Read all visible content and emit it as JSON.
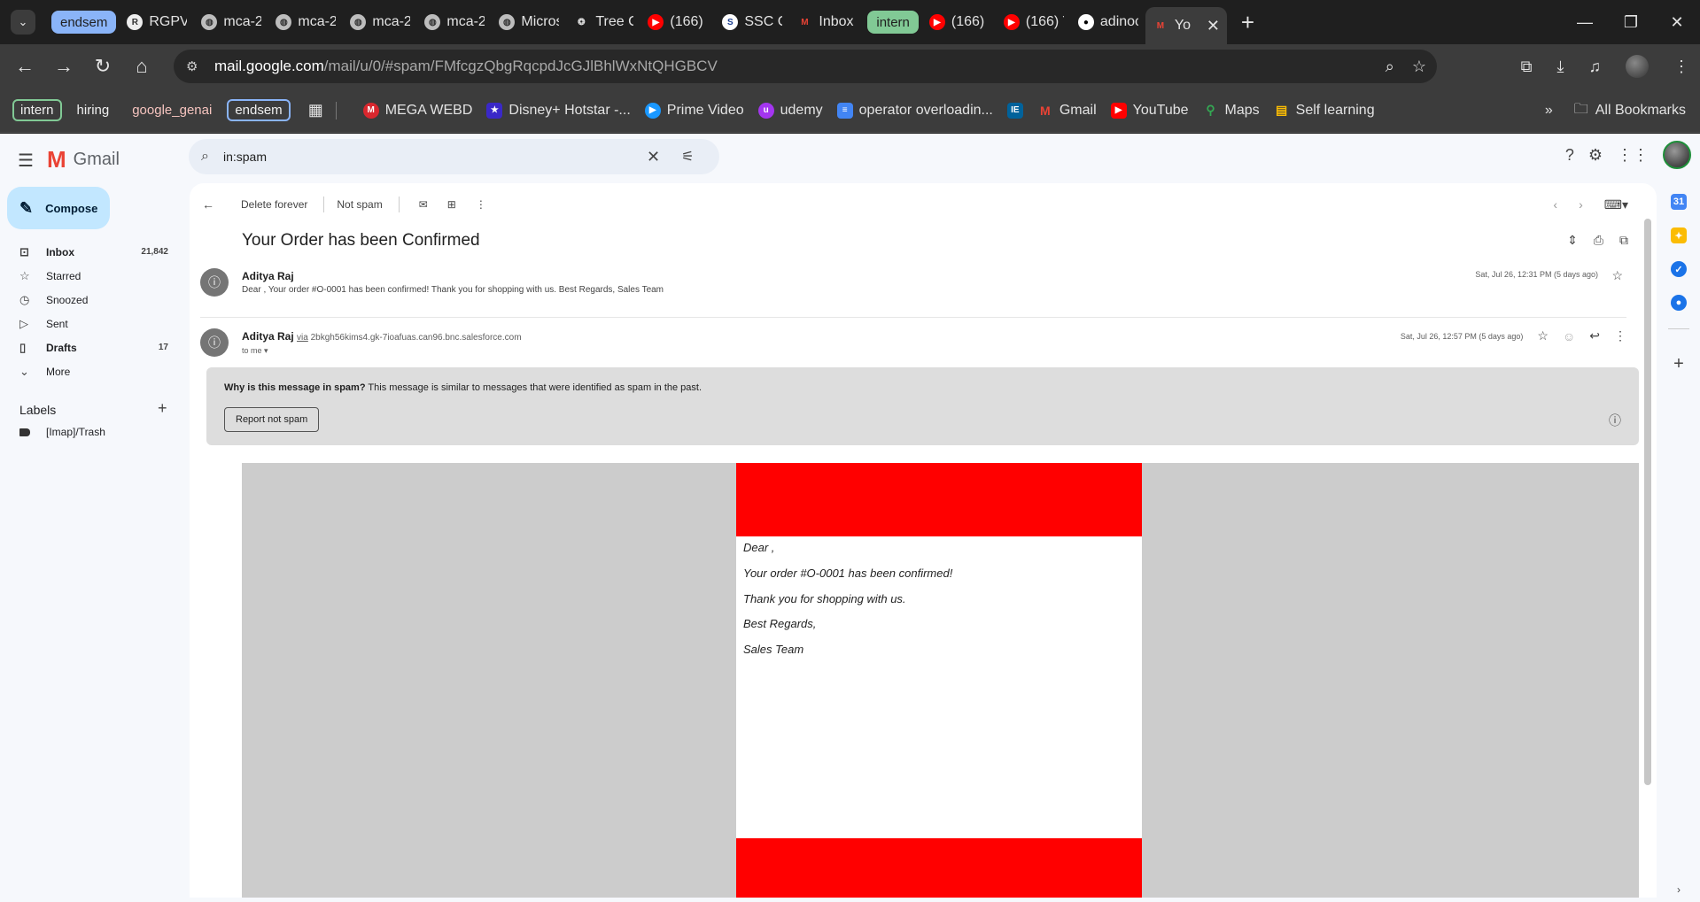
{
  "browser": {
    "tabs": [
      {
        "label": "endsem",
        "type": "group",
        "color": "#8ab4f8",
        "text_color": "#1f1f1f"
      },
      {
        "label": "RGPV",
        "icon": "rgpv-icon"
      },
      {
        "label": "mca-2",
        "icon": "globe-icon"
      },
      {
        "label": "mca-2",
        "icon": "globe-icon"
      },
      {
        "label": "mca-2",
        "icon": "globe-icon"
      },
      {
        "label": "mca-2",
        "icon": "globe-icon"
      },
      {
        "label": "Micros",
        "icon": "globe-icon"
      },
      {
        "label": "Tree C",
        "icon": "openai-icon"
      },
      {
        "label": "(166)",
        "icon": "youtube-icon"
      },
      {
        "label": "SSC C",
        "icon": "ssc-icon"
      },
      {
        "label": "Inbox",
        "icon": "gmail-icon"
      },
      {
        "label": "intern",
        "type": "group",
        "color": "#81c995",
        "text_color": "#1f1f1f"
      },
      {
        "label": "(166)",
        "icon": "youtube-icon"
      },
      {
        "label": "(166) Y",
        "icon": "youtube-icon"
      },
      {
        "label": "adinoc",
        "icon": "github-icon"
      },
      {
        "label": "Yo",
        "icon": "gmail-icon",
        "active": true
      }
    ],
    "url_host": "mail.google.com",
    "url_path": "/mail/u/0/#spam/FMfcgzQbgRqcpdJcGJlBhlWxNtQHGBCV",
    "bookmark_groups": [
      {
        "label": "intern",
        "color": "#81c995",
        "outlined": true
      },
      {
        "label": "hiring",
        "color": "#5f6368",
        "outlined": false
      },
      {
        "label": "google_genai",
        "color": "#f28b82",
        "outlined": false
      },
      {
        "label": "endsem",
        "color": "#8ab4f8",
        "outlined": true
      }
    ],
    "bookmarks": [
      {
        "label": "MEGA WEBD",
        "icon": "mega-icon",
        "color": "#d9272e"
      },
      {
        "label": "Disney+ Hotstar -...",
        "icon": "hotstar-icon",
        "color": "#3a28c8"
      },
      {
        "label": "Prime Video",
        "icon": "prime-icon",
        "color": "#1a98ff"
      },
      {
        "label": "udemy",
        "icon": "udemy-icon",
        "color": "#a435f0"
      },
      {
        "label": "operator overloadin...",
        "icon": "docs-icon",
        "color": "#4285f4"
      },
      {
        "label": "",
        "icon": "ieee-icon",
        "color": "#00629b"
      },
      {
        "label": "Gmail",
        "icon": "gmail-icon",
        "color": "#ea4335"
      },
      {
        "label": "YouTube",
        "icon": "youtube-icon",
        "color": "#ff0000"
      },
      {
        "label": "Maps",
        "icon": "maps-icon",
        "color": "#34a853"
      },
      {
        "label": "Self learning",
        "icon": "sheets-icon",
        "color": "#fbbc04"
      }
    ],
    "all_bookmarks": "All Bookmarks"
  },
  "gmail": {
    "brand": "Gmail",
    "search_value": "in:spam",
    "compose": "Compose",
    "nav": [
      {
        "label": "Inbox",
        "count": "21,842",
        "bold": true,
        "icon": "inbox-icon"
      },
      {
        "label": "Starred",
        "count": "",
        "bold": false,
        "icon": "star-icon"
      },
      {
        "label": "Snoozed",
        "count": "",
        "bold": false,
        "icon": "clock-icon"
      },
      {
        "label": "Sent",
        "count": "",
        "bold": false,
        "icon": "send-icon"
      },
      {
        "label": "Drafts",
        "count": "17",
        "bold": true,
        "icon": "draft-icon"
      },
      {
        "label": "More",
        "count": "",
        "bold": false,
        "icon": "chevron-down-icon"
      }
    ],
    "labels_heading": "Labels",
    "labels": [
      "[Imap]/Trash"
    ],
    "toolbar": {
      "delete_forever": "Delete forever",
      "not_spam": "Not spam"
    },
    "subject": "Your Order has been Confirmed",
    "message1": {
      "sender": "Aditya Raj",
      "snippet": "Dear , Your order #O-0001 has been confirmed! Thank you for shopping with us. Best Regards, Sales Team",
      "date": "Sat, Jul 26, 12:31 PM (5 days ago)"
    },
    "message2": {
      "sender": "Aditya Raj",
      "via_label": "via",
      "via_address": "2bkgh56kims4.gk-7ioafuas.can96.bnc.salesforce.com",
      "to": "to me",
      "date": "Sat, Jul 26, 12:57 PM (5 days ago)"
    },
    "spam_notice": {
      "question": "Why is this message in spam?",
      "explanation": " This message is similar to messages that were identified as spam in the past.",
      "button": "Report not spam"
    },
    "email_body": {
      "greeting": "Dear ,",
      "line1": "Your order #O-0001 has been confirmed!",
      "line2": "Thank you for shopping with us.",
      "regards": "Best Regards,",
      "team": "Sales Team"
    }
  }
}
